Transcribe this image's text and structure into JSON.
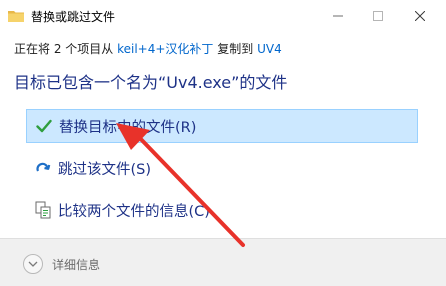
{
  "window": {
    "title": "替换或跳过文件",
    "minimize_icon": "minimize-icon",
    "maximize_icon": "maximize-icon",
    "close_icon": "close-icon"
  },
  "progress": {
    "prefix": "正在将 2 个项目从",
    "source": "keil+4+汉化补丁",
    "middle": "复制到",
    "destination": "UV4"
  },
  "headline": "目标已包含一个名为“Uv4.exe”的文件",
  "options": [
    {
      "label": "替换目标中的文件(R)",
      "icon": "checkmark-icon",
      "selected": true
    },
    {
      "label": "跳过该文件(S)",
      "icon": "skip-arrow-icon",
      "selected": false
    },
    {
      "label": "比较两个文件的信息(C)",
      "icon": "compare-files-icon",
      "selected": false
    }
  ],
  "footer": {
    "details_label": "详细信息",
    "details_icon": "chevron-down-icon"
  },
  "colors": {
    "accent_text": "#1e3287",
    "link": "#0066cc",
    "selected_bg": "#cce8ff",
    "selected_border": "#99d1ff",
    "check_green": "#2e9e3e",
    "annotation_red": "#e8322a"
  }
}
